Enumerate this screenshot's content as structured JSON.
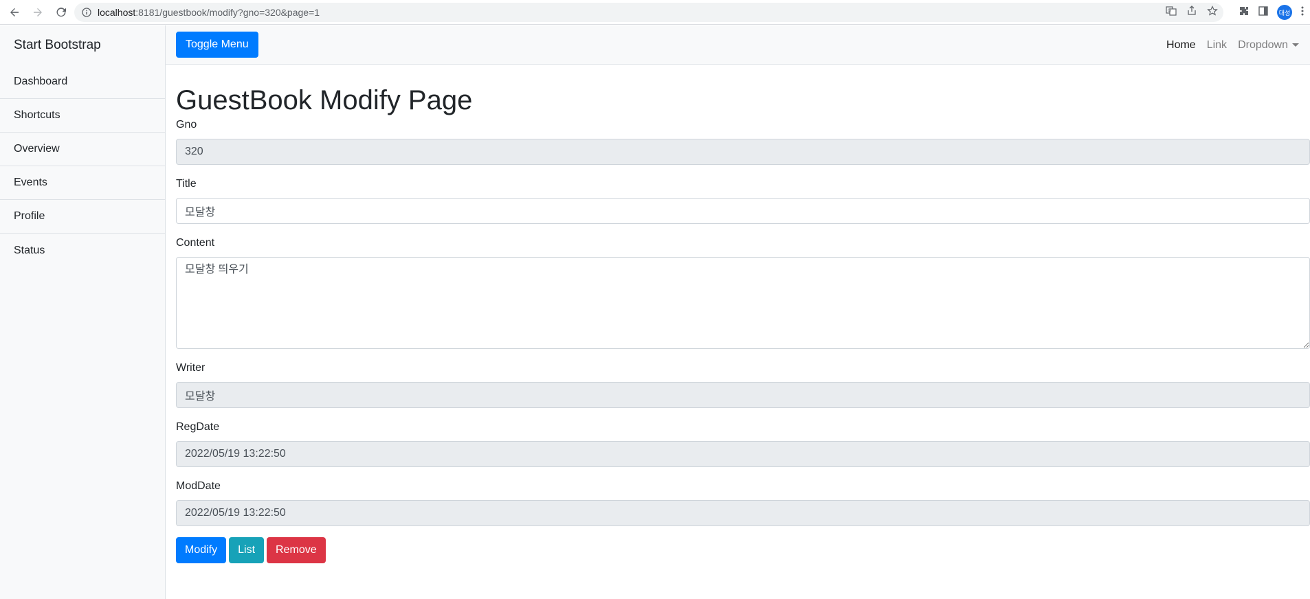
{
  "browser": {
    "url_host": "localhost",
    "url_path": ":8181/guestbook/modify?gno=320&page=1",
    "profile_initials": "대성"
  },
  "sidebar": {
    "heading": "Start Bootstrap",
    "items": [
      {
        "label": "Dashboard"
      },
      {
        "label": "Shortcuts"
      },
      {
        "label": "Overview"
      },
      {
        "label": "Events"
      },
      {
        "label": "Profile"
      },
      {
        "label": "Status"
      }
    ]
  },
  "navbar": {
    "toggle_label": "Toggle Menu",
    "links": [
      {
        "label": "Home"
      },
      {
        "label": "Link"
      },
      {
        "label": "Dropdown"
      }
    ]
  },
  "page": {
    "title": "GuestBook Modify Page"
  },
  "form": {
    "gno": {
      "label": "Gno",
      "value": "320"
    },
    "title": {
      "label": "Title",
      "value": "모달창"
    },
    "content": {
      "label": "Content",
      "value": "모달창 띄우기"
    },
    "writer": {
      "label": "Writer",
      "value": "모달창"
    },
    "regdate": {
      "label": "RegDate",
      "value": "2022/05/19 13:22:50"
    },
    "moddate": {
      "label": "ModDate",
      "value": "2022/05/19 13:22:50"
    }
  },
  "buttons": {
    "modify": "Modify",
    "list": "List",
    "remove": "Remove"
  },
  "colors": {
    "primary": "#007bff",
    "info": "#17a2b8",
    "danger": "#dc3545",
    "readonly_bg": "#e9ecef"
  }
}
